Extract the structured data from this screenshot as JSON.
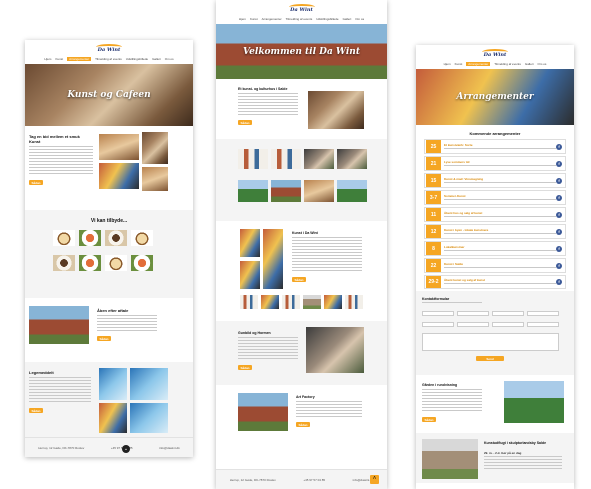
{
  "nav": [
    "Hjem",
    "Kunst",
    "Arrangementer",
    "Tilmelding af events",
    "Kunst og Cafe",
    "Udstillingsbillede",
    "Galleri",
    "Praktisk info",
    "Om os"
  ],
  "logo": "Da Wint",
  "page1": {
    "hero_title": "Kunst og Cafeen",
    "intro_heading": "Tag en bid mellem  et smuk Kunst",
    "intro_button": "Sådan",
    "offer_heading": "Vi kan tilbyde...",
    "evening_heading": "Åben efter aftale",
    "evening_button": "Sådan",
    "play_heading": "Legemeddelt",
    "play_button": "Sådan",
    "footer": [
      "Herrup, 12 Gøde, DK-7870 Roslev",
      "+45 97 57 04 85",
      "info@dawint.dk"
    ]
  },
  "page2": {
    "hero_title": "Velkommen til Da Wint",
    "intro_heading": "Et kunst- og kulturhus i Salde",
    "intro_button": "Sådan",
    "art_heading": "Kunst i Da Wint",
    "art_button": "Sådan",
    "owners_heading": "Gunbild og Hormen",
    "owners_button": "Sådan",
    "history_heading": "Art Factory",
    "history_button": "Sådan",
    "footer": [
      "Herrup, 12 Gøde, DK-7870 Roslev",
      "+45 97 57 04 85",
      "info@dawint.dk"
    ]
  },
  "page3": {
    "hero_title": "Arrangementer",
    "events_heading": "Kommende arrangementer",
    "events": [
      {
        "date": "25",
        "name": "Et kunstværk: Sorte"
      },
      {
        "date": "21",
        "name": "Lyse sommers tid"
      },
      {
        "date": "15",
        "name": "Kunst & mad: Vinsmagning"
      },
      {
        "date": "3-7",
        "name": "Sommer-Kunst"
      },
      {
        "date": "11",
        "name": "Åbent hus og salg af kunst"
      },
      {
        "date": "12",
        "name": "Kunst i byen - lokale kunstnere"
      },
      {
        "date": "8",
        "name": "Lokalkunstner"
      },
      {
        "date": "22",
        "name": "Kunst i Salde"
      },
      {
        "date": "29-2",
        "name": "Åbent kunst og salg af kunst"
      }
    ],
    "form_heading": "Kontaktformular",
    "form_button": "Send",
    "garden_heading": "Gården i rundvisning",
    "garden_button": "Sådan",
    "stone_heading": "Kunstudflugt i skulpturlandsby Salde",
    "stone_sub": "29. m. - 2.d. Gør på en dag"
  }
}
